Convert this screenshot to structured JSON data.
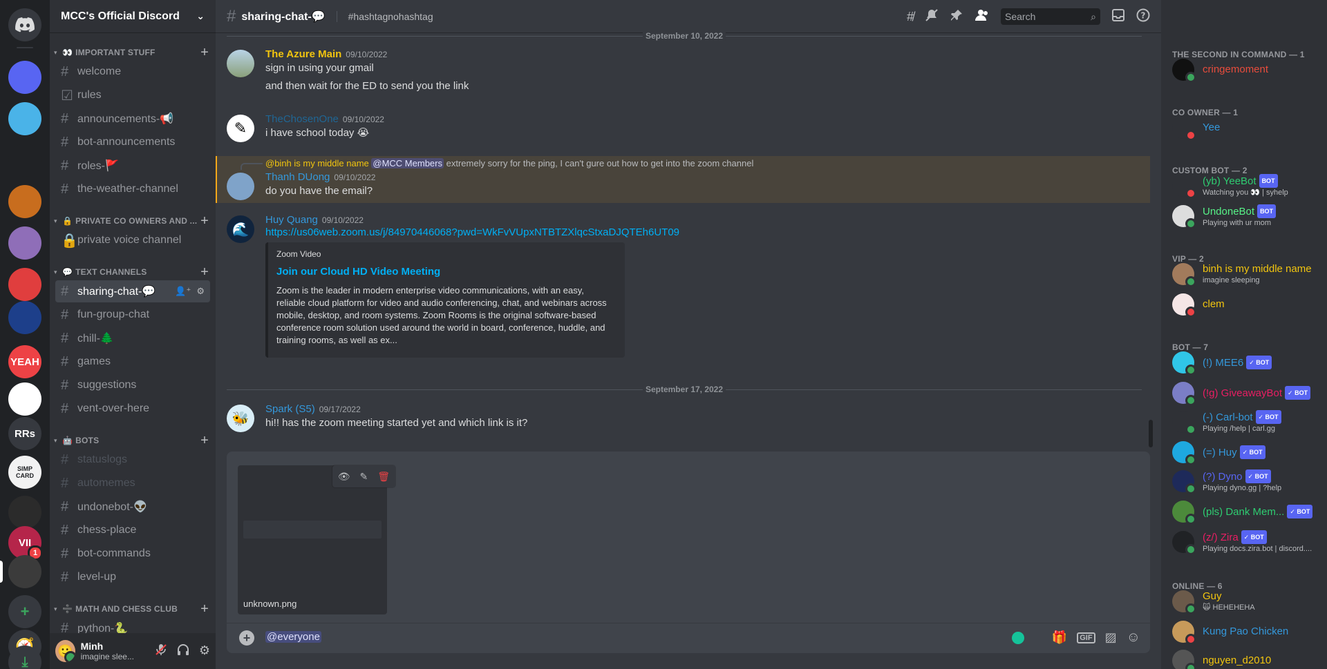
{
  "rail": {
    "servers": [
      {
        "label": "",
        "color": "#5865f2"
      },
      {
        "label": "",
        "color": "#4ab3e8"
      },
      {
        "label": "",
        "color": "#202225"
      },
      {
        "label": "",
        "color": "#c86d1e"
      },
      {
        "label": "",
        "color": "#8f6eb8"
      },
      {
        "label": "",
        "color": "#e03e3e"
      },
      {
        "label": "",
        "color": "#1d3f8a"
      },
      {
        "label": "YEAH",
        "color": "#ed4245"
      },
      {
        "label": "",
        "color": "#ffffff"
      },
      {
        "label": "RRs",
        "color": "#36393f"
      },
      {
        "label": "SIMP CARD",
        "color": "#f2f2f2"
      },
      {
        "label": "",
        "color": "#2b2b2b"
      },
      {
        "label": "VII",
        "color": "#b5254a",
        "badge": "1"
      },
      {
        "label": "",
        "color": "#3b3b3b"
      }
    ]
  },
  "guild": {
    "name": "MCC's Official Discord"
  },
  "sidebar": {
    "categories": [
      {
        "label": "IMPORTANT STUFF",
        "emoji": "👀"
      },
      {
        "label": "PRIVATE CO OWNERS AND ...",
        "emoji": "🔒"
      },
      {
        "label": "TEXT CHANNELS",
        "emoji": "💬"
      },
      {
        "label": "BOTS",
        "emoji": "🤖"
      },
      {
        "label": "MATH AND CHESS CLUB",
        "emoji": "➗"
      }
    ],
    "channels": [
      {
        "name": "welcome",
        "icon": "#"
      },
      {
        "name": "rules",
        "icon": "☑"
      },
      {
        "name": "announcements-📢",
        "icon": "#"
      },
      {
        "name": "bot-announcements",
        "icon": "#"
      },
      {
        "name": "roles-🚩",
        "icon": "#"
      },
      {
        "name": "the-weather-channel",
        "icon": "#"
      },
      {
        "name": "private voice channel",
        "icon": "🔒"
      },
      {
        "name": "sharing-chat-💬",
        "icon": "#"
      },
      {
        "name": "fun-group-chat",
        "icon": "#"
      },
      {
        "name": "chill-🌲",
        "icon": "#"
      },
      {
        "name": "games",
        "icon": "#"
      },
      {
        "name": "suggestions",
        "icon": "#"
      },
      {
        "name": "vent-over-here",
        "icon": "#"
      },
      {
        "name": "statuslogs",
        "icon": "#"
      },
      {
        "name": "automemes",
        "icon": "#"
      },
      {
        "name": "undonebot-👽",
        "icon": "#"
      },
      {
        "name": "chess-place",
        "icon": "#"
      },
      {
        "name": "bot-commands",
        "icon": "#"
      },
      {
        "name": "level-up",
        "icon": "#"
      },
      {
        "name": "python-🐍",
        "icon": "#"
      }
    ]
  },
  "user": {
    "name": "Minh",
    "status": "imagine slee..."
  },
  "channel": {
    "name": "sharing-chat-💬",
    "topic": "#hashtagnohashtag",
    "search_placeholder": "Search"
  },
  "dividers": [
    "September 10, 2022",
    "September 17, 2022"
  ],
  "messages": [
    {
      "author": "The Azure Main",
      "color": "#f1c40f",
      "time": "09/10/2022",
      "lines": [
        "sign in using your gmail",
        "and then wait for the ED to send you the link"
      ]
    },
    {
      "author": "TheChosenOne",
      "color": "#206694",
      "time": "09/10/2022",
      "lines": [
        "i have school today 😭"
      ]
    },
    {
      "author": "Thanh DUong",
      "color": "#3498db",
      "time": "09/10/2022",
      "reply_author": "@binh is my middle name",
      "reply_mention": "@MCC Members",
      "reply_text": "extremely sorry for the ping, I can't gure out how to get into the zoom channel",
      "lines": [
        "do you have the email?"
      ]
    },
    {
      "author": "Huy Quang",
      "color": "#3498db",
      "time": "09/10/2022",
      "link": "https://us06web.zoom.us/j/84970446068?pwd=WkFvVUpxNTBTZXlqcStxaDJQTEh6UT09",
      "embed": {
        "provider": "Zoom Video",
        "title": "Join our Cloud HD Video Meeting",
        "description": "Zoom is the leader in modern enterprise video communications, with an easy, reliable cloud platform for video and audio conferencing, chat, and webinars across mobile, desktop, and room systems. Zoom Rooms is the original software-based conference room solution used around the world in board, conference, huddle, and training rooms, as well as ex..."
      }
    },
    {
      "author": "Spark (S5)",
      "color": "#3498db",
      "time": "09/17/2022",
      "lines": [
        "hi!! has the zoom meeting started yet and which link is it?"
      ]
    }
  ],
  "composer": {
    "attachment_name": "unknown.png",
    "text": "@everyone",
    "gif_label": "GIF"
  },
  "members": {
    "groups": [
      {
        "label": "THE SECOND IN COMMAND — 1"
      },
      {
        "label": "CO OWNER — 1"
      },
      {
        "label": "CUSTOM BOT — 2"
      },
      {
        "label": "VIP — 2"
      },
      {
        "label": "BOT — 7"
      },
      {
        "label": "ONLINE — 6"
      }
    ],
    "list": [
      {
        "name": "cringemoment",
        "color": "#e74c3c",
        "activity": "",
        "bot": false,
        "status": "#3ba55d",
        "av": "#111111"
      },
      {
        "name": "Yee",
        "color": "#3498db",
        "activity": "",
        "bot": false,
        "status": "#ed4245",
        "av": "#2f3136"
      },
      {
        "name": "(yb) YeeBot",
        "color": "#2ecc71",
        "activity": "Watching you 👀 | syhelp",
        "bot": true,
        "botlabel": "BOT",
        "status": "#ed4245",
        "av": "#2f3136"
      },
      {
        "name": "UndoneBot",
        "color": "#57f287",
        "activity": "Playing with ur mom",
        "bot": true,
        "botlabel": "BOT",
        "status": "#3ba55d",
        "av": "#dddddd"
      },
      {
        "name": "binh is my middle name",
        "color": "#f1c40f",
        "activity": "imagine sleeping",
        "bot": false,
        "status": "#3ba55d",
        "av": "#a27b5c"
      },
      {
        "name": "clem",
        "color": "#f1c40f",
        "activity": "",
        "bot": false,
        "status": "#ed4245",
        "av": "#f5e6e6"
      },
      {
        "name": "(!) MEE6",
        "color": "#3498db",
        "activity": "",
        "bot": true,
        "botlabel": "✓ BOT",
        "status": "#3ba55d",
        "av": "#30c6e8"
      },
      {
        "name": "(!g) GiveawayBot",
        "color": "#e91e63",
        "activity": "",
        "bot": true,
        "botlabel": "✓ BOT",
        "status": "#3ba55d",
        "av": "#7b7ec6"
      },
      {
        "name": "(-) Carl-bot",
        "color": "#3498db",
        "activity": "Playing /help | carl.gg",
        "bot": true,
        "botlabel": "✓ BOT",
        "status": "#3ba55d",
        "av": "#2f3136"
      },
      {
        "name": "(=) Huy",
        "color": "#3498db",
        "activity": "",
        "bot": true,
        "botlabel": "✓ BOT",
        "status": "#3ba55d",
        "av": "#1ea8e0"
      },
      {
        "name": "(?) Dyno",
        "color": "#5865f2",
        "activity": "Playing dyno.gg | ?help",
        "bot": true,
        "botlabel": "✓ BOT",
        "status": "#3ba55d",
        "av": "#1e2a5a"
      },
      {
        "name": "(pls) Dank Mem...",
        "color": "#2ecc71",
        "activity": "",
        "bot": true,
        "botlabel": "✓ BOT",
        "status": "#3ba55d",
        "av": "#4c8a3b"
      },
      {
        "name": "(z/) Zira",
        "color": "#e91e63",
        "activity": "Playing docs.zira.bot | discord....",
        "bot": true,
        "botlabel": "✓ BOT",
        "status": "#3ba55d",
        "av": "#202225"
      },
      {
        "name": "Guy",
        "color": "#f1c40f",
        "activity": "🙀 HEHEHEHA",
        "bot": false,
        "status": "#3ba55d",
        "av": "#6b5a4a"
      },
      {
        "name": "Kung Pao Chicken",
        "color": "#3498db",
        "activity": "",
        "bot": false,
        "status": "#ed4245",
        "av": "#c79a5a"
      },
      {
        "name": "nguyen_d2010",
        "color": "#f1c40f",
        "activity": "",
        "bot": false,
        "status": "#3ba55d",
        "av": "#555555"
      }
    ]
  }
}
